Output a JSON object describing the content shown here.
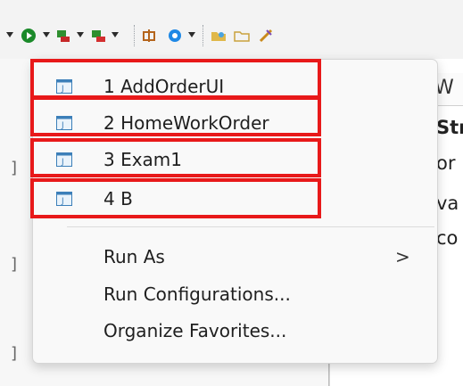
{
  "toolbar": {
    "icons": [
      "run-icon",
      "debug-icon",
      "coverage-icon",
      "build-icon",
      "external-tools-icon",
      "open-folder-icon",
      "open-file-icon",
      "pen-icon"
    ]
  },
  "background": {
    "tab_fragment": "W",
    "fragments": [
      "Str",
      "or",
      "va",
      "co"
    ],
    "brackets": [
      "]",
      "]",
      "]"
    ]
  },
  "menu": {
    "favorites": [
      {
        "label": "1 AddOrderUI"
      },
      {
        "label": "2 HomeWorkOrder"
      },
      {
        "label": "3 Exam1"
      },
      {
        "label": "4 B"
      }
    ],
    "actions": [
      {
        "label": "Run As",
        "has_submenu": true,
        "arrow": ">"
      },
      {
        "label": "Run Configurations..."
      },
      {
        "label": "Organize Favorites..."
      }
    ]
  },
  "colors": {
    "highlight_border": "#e8191a",
    "menu_background": "#f9f9f9"
  }
}
